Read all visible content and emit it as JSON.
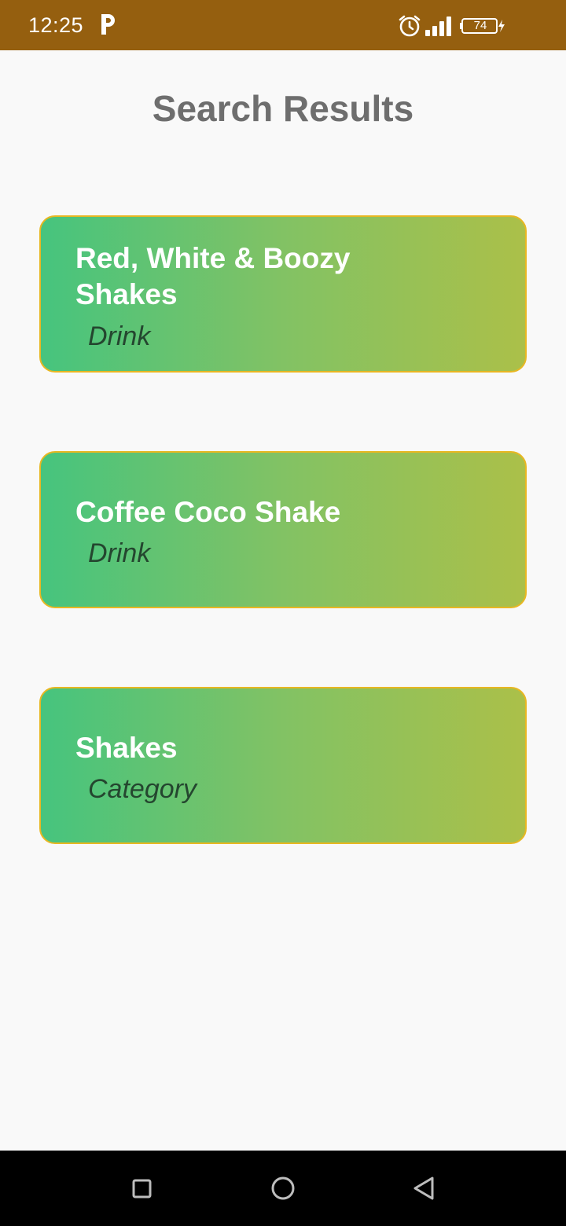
{
  "status_bar": {
    "time": "12:25",
    "notification_icon": "parking-p-icon",
    "icons": [
      "alarm-icon",
      "signal-icon",
      "battery-icon",
      "charging-bolt-icon"
    ],
    "battery_level": "74",
    "background_color": "#955f0f"
  },
  "header": {
    "title": "Search Results"
  },
  "results": [
    {
      "title": "Red, White & Boozy Shakes",
      "type": "Drink"
    },
    {
      "title": "Coffee Coco Shake",
      "type": "Drink"
    },
    {
      "title": "Shakes",
      "type": "Category"
    }
  ],
  "colors": {
    "card_gradient_start": "#46c47e",
    "card_gradient_end": "#abc049",
    "card_border": "#e8b722",
    "title_text": "#6e6e6e",
    "card_title_text": "#ffffff",
    "card_type_text": "#24462f"
  },
  "nav_bar": {
    "buttons": [
      "recents-square-icon",
      "home-circle-icon",
      "back-triangle-icon"
    ]
  }
}
